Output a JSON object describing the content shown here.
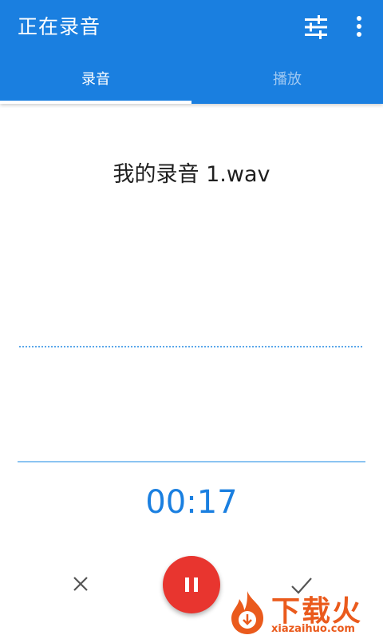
{
  "appbar": {
    "title": "正在录音",
    "actions": [
      {
        "icon": "tune-icon"
      },
      {
        "icon": "more-vert-icon"
      }
    ]
  },
  "tabs": [
    {
      "label": "录音",
      "selected": true
    },
    {
      "label": "播放",
      "selected": false
    }
  ],
  "recording": {
    "filename": "我的录音 1.wav",
    "elapsed": "00:17"
  },
  "controls": {
    "cancel_icon": "close-icon",
    "pause_icon": "pause-icon",
    "confirm_icon": "check-icon"
  },
  "watermark": {
    "text": "下载火",
    "url": "xiazaihuo.com"
  },
  "colors": {
    "primary": "#1a7fe0",
    "accent": "#e8352f",
    "watermark": "#ea5a1c"
  }
}
